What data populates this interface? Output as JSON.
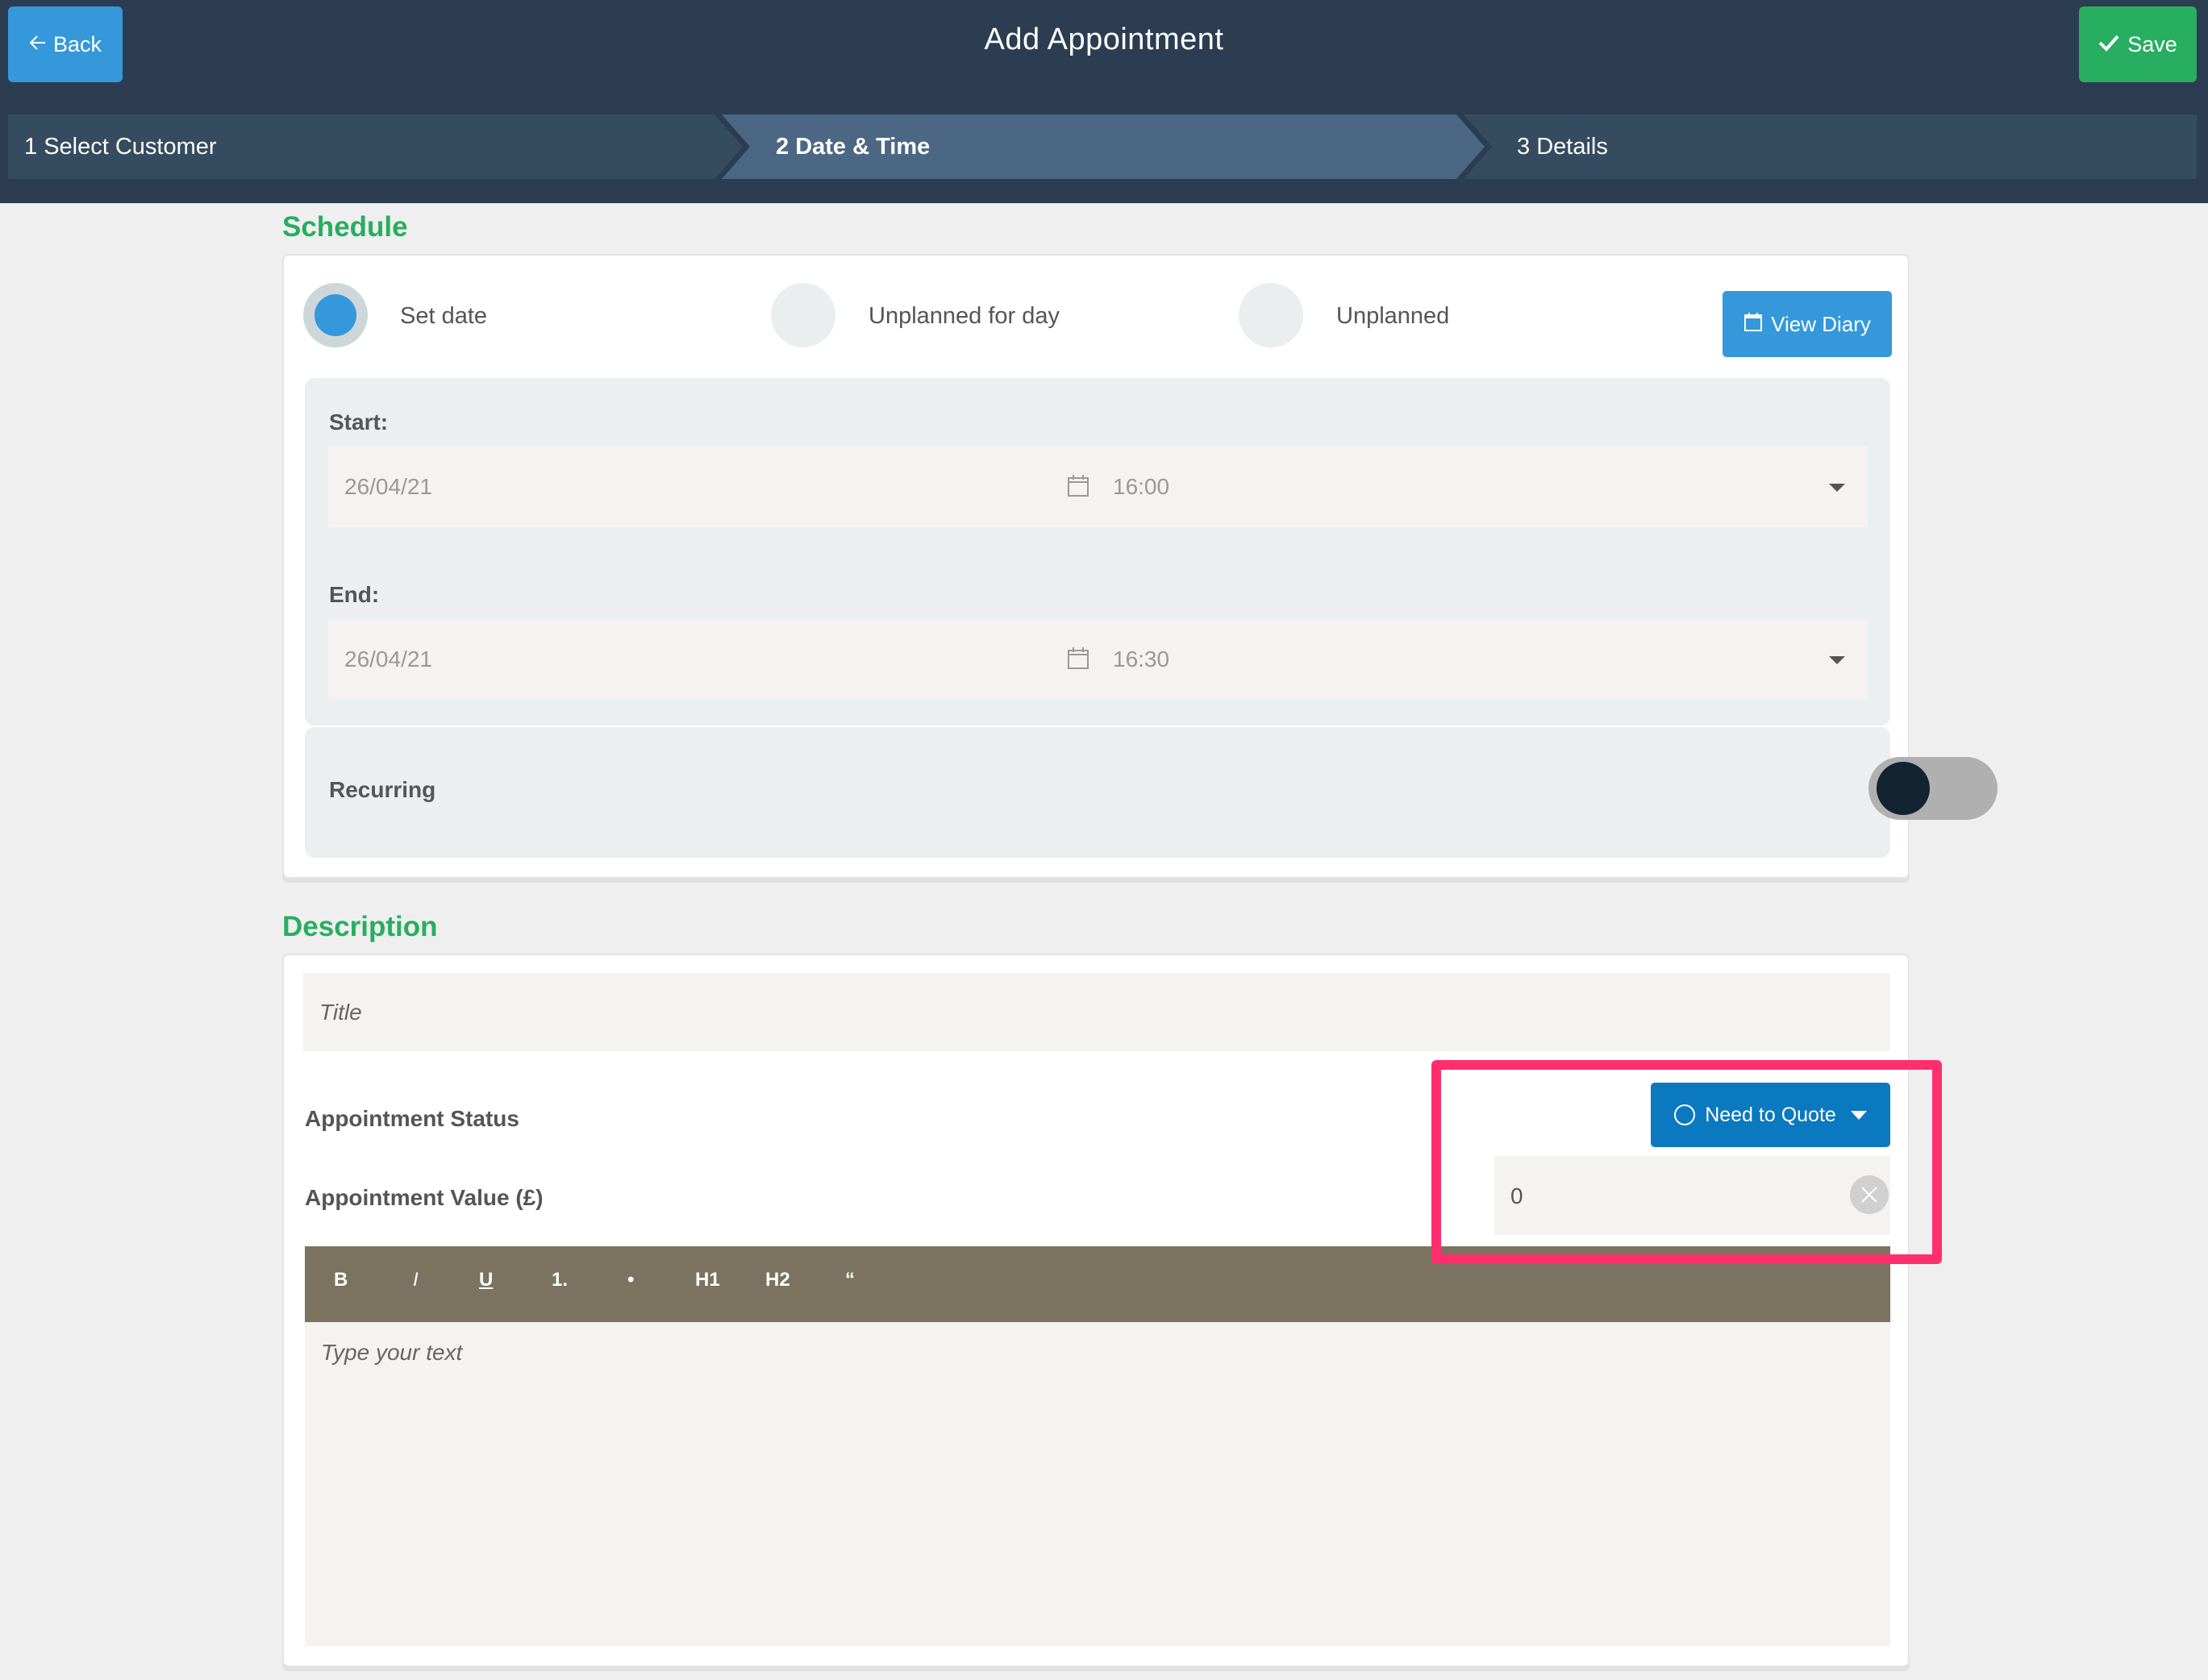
{
  "header": {
    "title": "Add Appointment",
    "back_label": "Back",
    "back_icon": "arrow-left-icon",
    "save_label": "Save",
    "save_icon": "checkmark-icon"
  },
  "steps": [
    {
      "number": "1",
      "label": "Select Customer",
      "active": false
    },
    {
      "number": "2",
      "label": "Date & Time",
      "active": true
    },
    {
      "number": "3",
      "label": "Details",
      "active": false
    }
  ],
  "schedule": {
    "heading": "Schedule",
    "options": [
      {
        "label": "Set date",
        "selected": true
      },
      {
        "label": "Unplanned for day",
        "selected": false
      },
      {
        "label": "Unplanned",
        "selected": false
      }
    ],
    "view_diary_label": "View Diary",
    "view_diary_icon": "calendar-icon",
    "start": {
      "label": "Start:",
      "date": "26/04/21",
      "time": "16:00"
    },
    "end": {
      "label": "End:",
      "date": "26/04/21",
      "time": "16:30"
    },
    "recurring": {
      "label": "Recurring",
      "enabled": false
    }
  },
  "description": {
    "heading": "Description",
    "title_placeholder": "Title",
    "status": {
      "label": "Appointment Status",
      "value": "Need to Quote"
    },
    "value": {
      "label": "Appointment Value (£)",
      "amount": "0"
    },
    "toolbar": [
      {
        "name": "bold",
        "label": "B"
      },
      {
        "name": "italic",
        "label": "I"
      },
      {
        "name": "underline",
        "label": "U"
      },
      {
        "name": "ordered-list",
        "label": "1."
      },
      {
        "name": "bullet-list",
        "label": "•"
      },
      {
        "name": "heading-1",
        "label": "H1"
      },
      {
        "name": "heading-2",
        "label": "H2"
      },
      {
        "name": "quote",
        "label": "“"
      }
    ],
    "editor_placeholder": "Type your text"
  },
  "colors": {
    "header_bg": "#2c3d52",
    "back_button": "#3498db",
    "save_button": "#27ae60",
    "section_heading": "#27ae60",
    "status_button": "#0b79c0",
    "toolbar_bg": "#7b7360",
    "highlight": "#ff2f6d"
  }
}
